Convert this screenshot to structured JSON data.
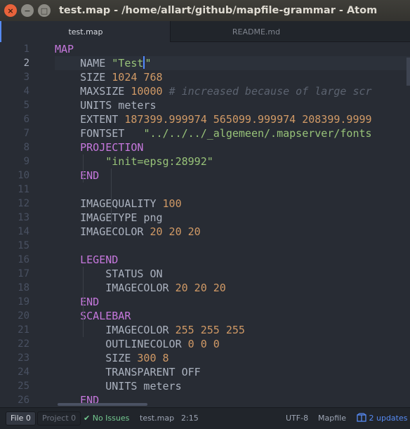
{
  "window": {
    "title": "test.map - /home/allart/github/mapfile-grammar - Atom",
    "close_glyph": "×",
    "min_glyph": "−",
    "max_glyph": "□"
  },
  "tabs": [
    {
      "label": "test.map",
      "active": true
    },
    {
      "label": "README.md",
      "active": false
    }
  ],
  "editor": {
    "current_line": 2,
    "line_numbers": [
      "1",
      "2",
      "3",
      "4",
      "5",
      "6",
      "7",
      "8",
      "9",
      "10",
      "11",
      "12",
      "13",
      "14",
      "15",
      "16",
      "17",
      "18",
      "19",
      "20",
      "21",
      "22",
      "23",
      "24",
      "25",
      "26"
    ],
    "lines": [
      [
        {
          "t": "k",
          "v": "MAP"
        }
      ],
      [
        {
          "t": "p",
          "v": "    NAME "
        },
        {
          "t": "s",
          "v": "\"Test"
        },
        {
          "t": "cursor",
          "v": ""
        },
        {
          "t": "s",
          "v": "\""
        }
      ],
      [
        {
          "t": "p",
          "v": "    SIZE "
        },
        {
          "t": "n",
          "v": "1024 768"
        }
      ],
      [
        {
          "t": "p",
          "v": "    MAXSIZE "
        },
        {
          "t": "n",
          "v": "10000"
        },
        {
          "t": "p",
          "v": " "
        },
        {
          "t": "c",
          "v": "# increased because of large scr"
        }
      ],
      [
        {
          "t": "p",
          "v": "    UNITS meters"
        }
      ],
      [
        {
          "t": "p",
          "v": "    EXTENT "
        },
        {
          "t": "n",
          "v": "187399.999974 565099.999974 208399.9999"
        }
      ],
      [
        {
          "t": "p",
          "v": "    FONTSET   "
        },
        {
          "t": "s",
          "v": "\"../../../_algemeen/.mapserver/fonts"
        }
      ],
      [
        {
          "t": "p",
          "v": "    "
        },
        {
          "t": "k",
          "v": "PROJECTION"
        }
      ],
      [
        {
          "t": "p",
          "v": "        "
        },
        {
          "t": "s",
          "v": "\"init=epsg:28992\""
        }
      ],
      [
        {
          "t": "p",
          "v": "    "
        },
        {
          "t": "k",
          "v": "END"
        }
      ],
      [],
      [
        {
          "t": "p",
          "v": "    IMAGEQUALITY "
        },
        {
          "t": "n",
          "v": "100"
        }
      ],
      [
        {
          "t": "p",
          "v": "    IMAGETYPE png"
        }
      ],
      [
        {
          "t": "p",
          "v": "    IMAGECOLOR "
        },
        {
          "t": "n",
          "v": "20 20 20"
        }
      ],
      [],
      [
        {
          "t": "p",
          "v": "    "
        },
        {
          "t": "k",
          "v": "LEGEND"
        }
      ],
      [
        {
          "t": "p",
          "v": "        STATUS ON"
        }
      ],
      [
        {
          "t": "p",
          "v": "        IMAGECOLOR "
        },
        {
          "t": "n",
          "v": "20 20 20"
        }
      ],
      [
        {
          "t": "p",
          "v": "    "
        },
        {
          "t": "k",
          "v": "END"
        }
      ],
      [
        {
          "t": "p",
          "v": "    "
        },
        {
          "t": "k",
          "v": "SCALEBAR"
        }
      ],
      [
        {
          "t": "p",
          "v": "        IMAGECOLOR "
        },
        {
          "t": "n",
          "v": "255 255 255"
        }
      ],
      [
        {
          "t": "p",
          "v": "        OUTLINECOLOR "
        },
        {
          "t": "n",
          "v": "0 0 0"
        }
      ],
      [
        {
          "t": "p",
          "v": "        SIZE "
        },
        {
          "t": "n",
          "v": "300 8"
        }
      ],
      [
        {
          "t": "p",
          "v": "        TRANSPARENT OFF"
        }
      ],
      [
        {
          "t": "p",
          "v": "        UNITS meters"
        }
      ],
      [
        {
          "t": "p",
          "v": "    "
        },
        {
          "t": "k",
          "v": "END"
        }
      ]
    ]
  },
  "statusbar": {
    "file_label": "File",
    "file_count": "0",
    "project_label": "Project",
    "project_count": "0",
    "issues_icon": "✔",
    "issues_label": "No Issues",
    "filename": "test.map",
    "cursor_pos": "2:15",
    "encoding": "UTF-8",
    "grammar": "Mapfile",
    "updates_icon": "package-icon",
    "updates_label": "2 updates"
  },
  "colors": {
    "keyword": "#c678dd",
    "string": "#98c379",
    "number": "#d19a66",
    "comment": "#5c6370",
    "accent": "#568af2"
  }
}
